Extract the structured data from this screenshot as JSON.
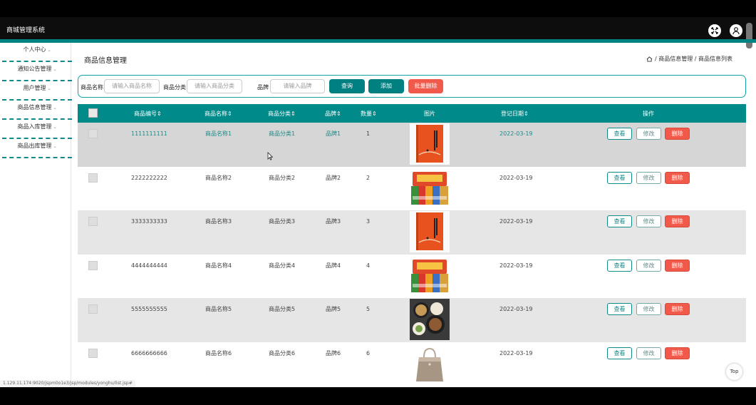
{
  "app": {
    "title": "商城管理系统"
  },
  "sidebar": {
    "items": [
      {
        "label": "个人中心"
      },
      {
        "label": "通知公告管理"
      },
      {
        "label": "用户管理"
      },
      {
        "label": "商品信息管理"
      },
      {
        "label": "商品入库管理"
      },
      {
        "label": "商品出库管理"
      }
    ]
  },
  "page": {
    "title": "商品信息管理",
    "breadcrumb": "/ 商品信息管理 / 商品信息列表"
  },
  "search": {
    "name_label": "商品名称",
    "name_placeholder": "请输入商品名称",
    "category_label": "商品分类",
    "category_placeholder": "请输入商品分类",
    "brand_label": "品牌",
    "brand_placeholder": "请输入品牌",
    "query": "查询",
    "add": "添加",
    "batch_delete": "批量删除"
  },
  "table": {
    "columns": [
      "商品编号",
      "商品名称",
      "商品分类",
      "品牌",
      "数量",
      "图片",
      "登记日期",
      "操作"
    ],
    "actions": {
      "view": "查看",
      "edit": "修改",
      "delete": "删除"
    },
    "rows": [
      {
        "code": "1111111111",
        "name": "商品名称1",
        "category": "商品分类1",
        "brand": "品牌1",
        "qty": "1",
        "image": "orange-tea-box",
        "date": "2022-03-19"
      },
      {
        "code": "2222222222",
        "name": "商品名称2",
        "category": "商品分类2",
        "brand": "品牌2",
        "qty": "2",
        "image": "snack-packs",
        "date": "2022-03-19"
      },
      {
        "code": "3333333333",
        "name": "商品名称3",
        "category": "商品分类3",
        "brand": "品牌3",
        "qty": "3",
        "image": "orange-tea-box",
        "date": "2022-03-19"
      },
      {
        "code": "4444444444",
        "name": "商品名称4",
        "category": "商品分类4",
        "brand": "品牌4",
        "qty": "4",
        "image": "snack-packs",
        "date": "2022-03-19"
      },
      {
        "code": "5555555555",
        "name": "商品名称5",
        "category": "商品分类5",
        "brand": "品牌5",
        "qty": "5",
        "image": "food-tray",
        "date": "2022-03-19"
      },
      {
        "code": "6666666666",
        "name": "商品名称6",
        "category": "商品分类6",
        "brand": "品牌6",
        "qty": "6",
        "image": "handbag",
        "date": "2022-03-19"
      }
    ]
  },
  "top_button": "Top",
  "status_url": "1.129.11.174:9020/jspm0o1e3/jsp/modules/yonghu/list.jsp#",
  "colors": {
    "accent": "#008383",
    "danger": "#f15a4a"
  }
}
